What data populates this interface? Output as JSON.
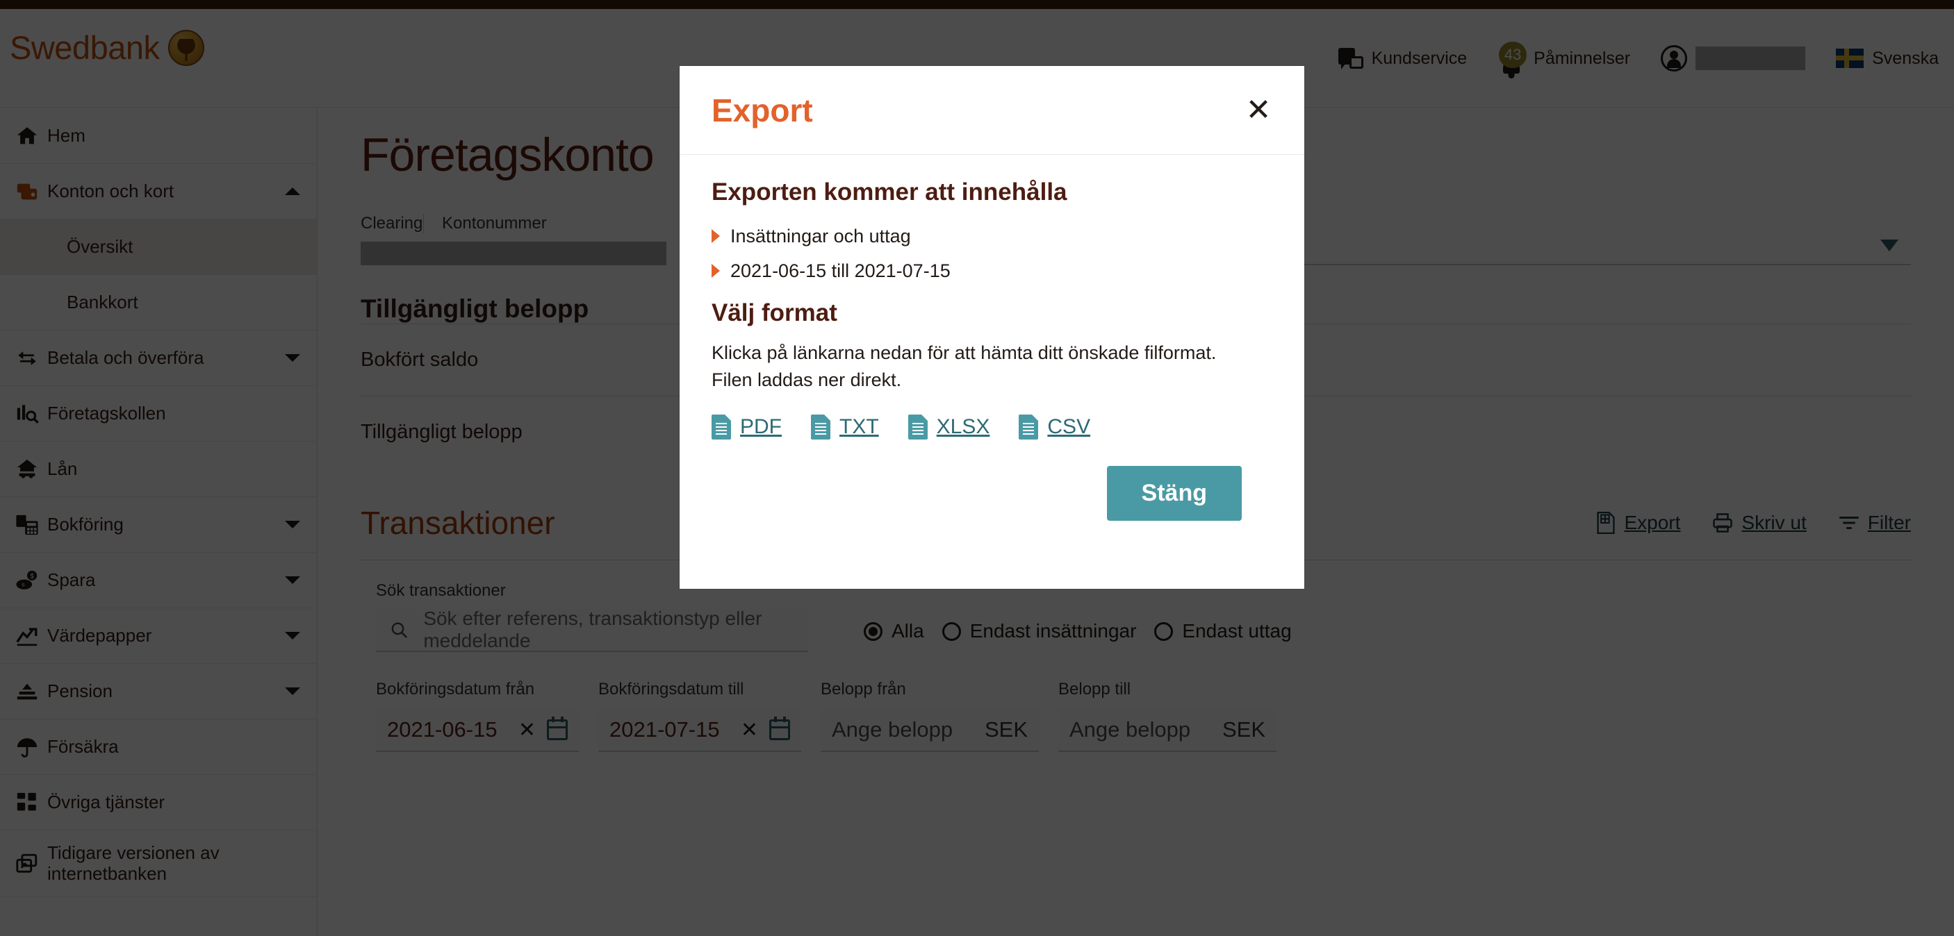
{
  "brand": {
    "name": "Swedbank",
    "accent_orange": "#c1500f",
    "accent_teal": "#4a9aa5",
    "topbar_color": "#3d1f0a"
  },
  "header": {
    "customer_service": "Kundservice",
    "reminders_label": "Påminnelser",
    "reminders_count": "43",
    "language": "Svenska"
  },
  "sidebar": {
    "items": [
      {
        "label": "Hem",
        "icon": "home-icon",
        "expandable": false
      },
      {
        "label": "Konton och kort",
        "icon": "cards-icon",
        "expandable": true,
        "expanded": true
      },
      {
        "label": "Översikt",
        "icon": "",
        "sub": true,
        "active": true
      },
      {
        "label": "Bankkort",
        "icon": "",
        "sub": true,
        "active": false
      },
      {
        "label": "Betala och överföra",
        "icon": "transfer-icon",
        "expandable": true
      },
      {
        "label": "Företagskollen",
        "icon": "business-insight-icon",
        "expandable": false
      },
      {
        "label": "Lån",
        "icon": "loan-icon",
        "expandable": false
      },
      {
        "label": "Bokföring",
        "icon": "accounting-icon",
        "expandable": true
      },
      {
        "label": "Spara",
        "icon": "savings-icon",
        "expandable": true
      },
      {
        "label": "Värdepapper",
        "icon": "securities-icon",
        "expandable": true
      },
      {
        "label": "Pension",
        "icon": "pension-icon",
        "expandable": true
      },
      {
        "label": "Försäkra",
        "icon": "umbrella-icon",
        "expandable": false
      },
      {
        "label": "Övriga tjänster",
        "icon": "grid-icon",
        "expandable": false
      },
      {
        "label": "Tidigare versionen av internetbanken",
        "icon": "external-window-icon",
        "expandable": false
      }
    ]
  },
  "main": {
    "page_title": "Företagskonto",
    "account": {
      "clearing_header": "Clearing",
      "accountnumber_header": "Kontonummer",
      "selector_value": ")"
    },
    "available": {
      "title": "Tillgängligt belopp",
      "rows": [
        {
          "label": "Bokfört saldo",
          "value": ""
        },
        {
          "label": "Tillgängligt belopp",
          "value": ""
        }
      ]
    },
    "transactions": {
      "title": "Transaktioner",
      "tools": [
        {
          "label": "Export",
          "icon": "export-icon"
        },
        {
          "label": "Skriv ut",
          "icon": "printer-icon"
        },
        {
          "label": "Filter",
          "icon": "filter-icon"
        }
      ],
      "search_label": "Sök transaktioner",
      "search_placeholder": "Sök efter referens, transaktionstyp eller meddelande",
      "radios": [
        {
          "label": "Alla",
          "selected": true
        },
        {
          "label": "Endast insättningar",
          "selected": false
        },
        {
          "label": "Endast uttag",
          "selected": false
        }
      ],
      "filters": [
        {
          "label": "Bokföringsdatum från",
          "value": "2021-06-15",
          "clear": "✕",
          "icon": "calendar-icon"
        },
        {
          "label": "Bokföringsdatum till",
          "value": "2021-07-15",
          "clear": "✕",
          "icon": "calendar-icon"
        },
        {
          "label": "Belopp från",
          "placeholder": "Ange belopp",
          "unit": "SEK"
        },
        {
          "label": "Belopp till",
          "placeholder": "Ange belopp",
          "unit": "SEK"
        }
      ]
    }
  },
  "modal": {
    "title": "Export",
    "close_label": "✕",
    "contents_heading": "Exporten kommer att innehålla",
    "contents_items": [
      "Insättningar och uttag",
      "2021-06-15 till 2021-07-15"
    ],
    "format_heading": "Välj format",
    "format_description": "Klicka på länkarna nedan för att hämta ditt önskade filformat. Filen laddas ner direkt.",
    "formats": [
      {
        "label": "PDF",
        "icon": "document-icon"
      },
      {
        "label": "TXT",
        "icon": "document-icon"
      },
      {
        "label": "XLSX",
        "icon": "document-icon"
      },
      {
        "label": "CSV",
        "icon": "document-icon"
      }
    ],
    "close_button": "Stäng"
  }
}
